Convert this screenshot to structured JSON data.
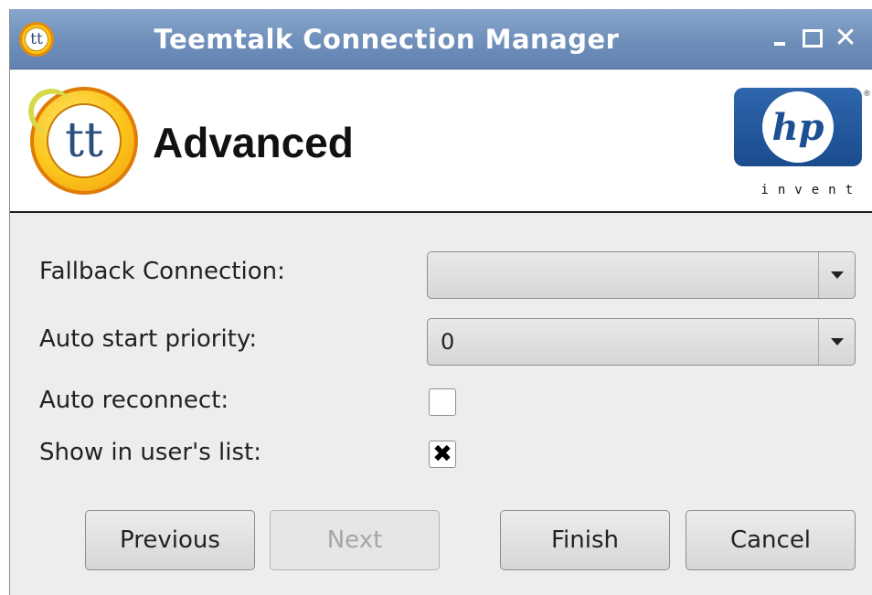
{
  "window": {
    "title": "Teemtalk Connection Manager",
    "app_icon_text": "tt",
    "controls": [
      "minimize-icon",
      "maximize-icon",
      "close-icon"
    ],
    "close_glyph": "✕"
  },
  "header": {
    "title": "Advanced",
    "logo_text": "tt",
    "brand_logo_text": "hp",
    "brand_tagline": "invent",
    "brand_mark": "®"
  },
  "form": {
    "fallback_label": "Fallback Connection:",
    "fallback_value": "",
    "priority_label": "Auto start priority:",
    "priority_value": "0",
    "reconnect_label": "Auto reconnect:",
    "reconnect_checked": false,
    "showlist_label": "Show in user's list:",
    "showlist_checked": true,
    "showlist_glyph": "✖"
  },
  "buttons": {
    "previous": "Previous",
    "next": "Next",
    "next_enabled": false,
    "finish": "Finish",
    "cancel": "Cancel"
  },
  "colors": {
    "titlebar": "#6e8fba",
    "accent_orange": "#fbc51a",
    "hp_blue": "#1d4f93"
  }
}
